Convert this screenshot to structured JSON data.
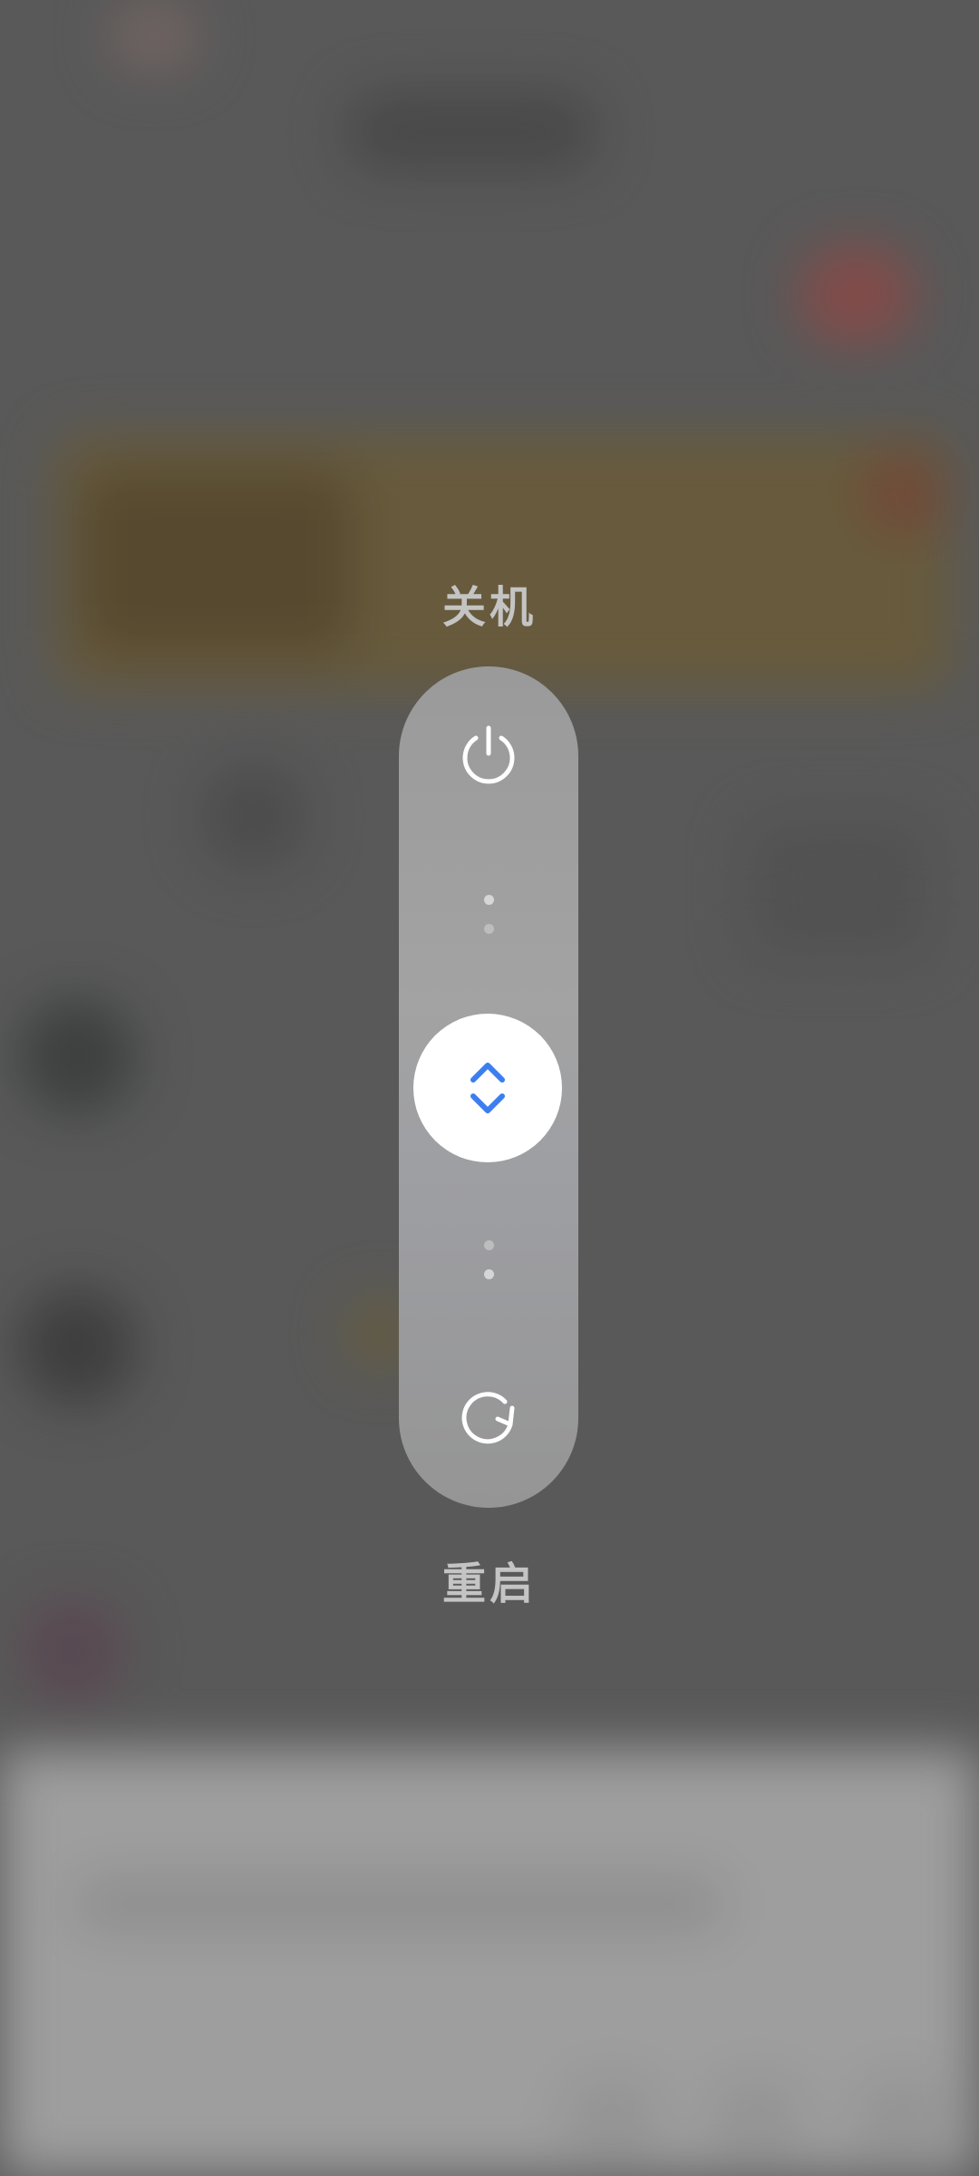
{
  "power_menu": {
    "shutdown_label": "关机",
    "restart_label": "重启",
    "icons": {
      "top": "power-icon",
      "thumb": "up-down-chevron-icon",
      "bottom": "restart-icon"
    },
    "accent_color": "#3b7ef0"
  }
}
